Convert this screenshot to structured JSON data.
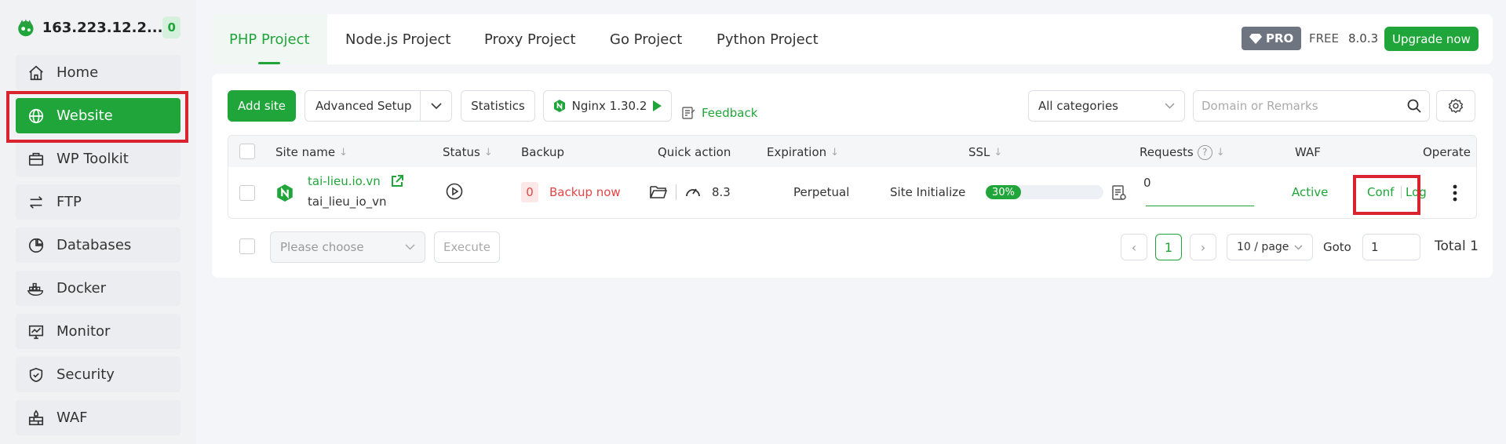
{
  "sidebar": {
    "server_ip": "163.223.12.2...",
    "server_count": "0",
    "items": [
      {
        "label": "Home",
        "icon": "home-icon"
      },
      {
        "label": "Website",
        "icon": "globe-icon"
      },
      {
        "label": "WP Toolkit",
        "icon": "briefcase-icon"
      },
      {
        "label": "FTP",
        "icon": "transfer-icon"
      },
      {
        "label": "Databases",
        "icon": "database-icon"
      },
      {
        "label": "Docker",
        "icon": "docker-icon"
      },
      {
        "label": "Monitor",
        "icon": "monitor-icon"
      },
      {
        "label": "Security",
        "icon": "shield-icon"
      },
      {
        "label": "WAF",
        "icon": "firewall-icon"
      }
    ]
  },
  "tabs": {
    "items": [
      "PHP Project",
      "Node.js Project",
      "Proxy Project",
      "Go Project",
      "Python Project"
    ],
    "pro_label": "PRO",
    "free_label": "FREE",
    "version": "8.0.3",
    "upgrade_label": "Upgrade now"
  },
  "toolbar": {
    "add_site": "Add site",
    "advanced_setup": "Advanced Setup",
    "statistics": "Statistics",
    "nginx": "Nginx 1.30.2",
    "feedback": "Feedback",
    "category": "All categories",
    "search_placeholder": "Domain or Remarks"
  },
  "table": {
    "headers": {
      "site_name": "Site name",
      "status": "Status",
      "backup": "Backup",
      "quick_action": "Quick action",
      "expiration": "Expiration",
      "ssl": "SSL",
      "requests": "Requests",
      "waf": "WAF",
      "operate": "Operate"
    },
    "rows": [
      {
        "domain": "tai-lieu.io.vn",
        "remark": "tai_lieu_io_vn",
        "backup_count": "0",
        "backup_action": "Backup now",
        "php_version": "8.3",
        "expiration": "Perpetual",
        "ssl_status": "Site Initialize",
        "ssl_progress": "30%",
        "ssl_progress_value": 0.3,
        "requests": "0",
        "waf": "Active",
        "conf": "Conf",
        "log": "Log"
      }
    ]
  },
  "footer": {
    "batch_placeholder": "Please choose",
    "execute": "Execute",
    "page": "1",
    "page_size": "10 / page",
    "goto_label": "Goto",
    "goto_value": "1",
    "total": "Total 1"
  },
  "colors": {
    "accent": "#20a53a",
    "highlight": "#d9232e",
    "danger": "#e54545"
  }
}
